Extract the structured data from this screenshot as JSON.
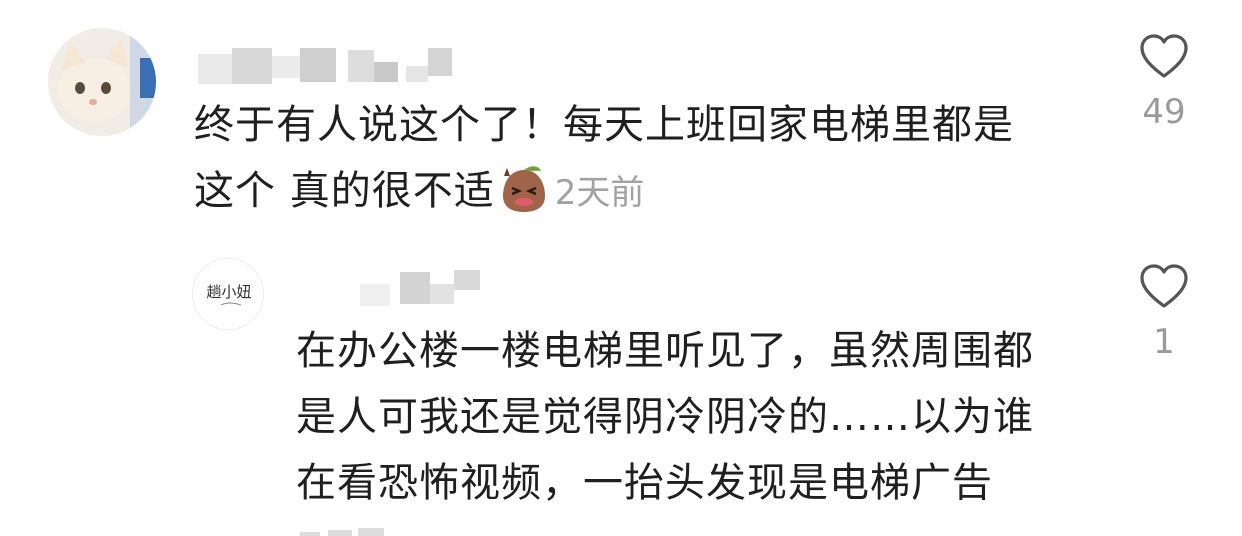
{
  "comments": [
    {
      "text_lines": [
        "终于有人说这个了！每天上班回家电梯里都是",
        "这个 真的很不适"
      ],
      "sticker_icon": "sweating-blob-icon",
      "time": "2天前",
      "likes": "49"
    },
    {
      "avatar_text": "趟小妞",
      "text_lines": [
        "在办公楼一楼电梯里听见了，虽然周围都",
        "是人可我还是觉得阴冷阴冷的……以为谁",
        "在看恐怖视频，一抬头发现是电梯广告"
      ],
      "likes": "1"
    }
  ],
  "colors": {
    "text": "#1f1f1f",
    "secondary": "#a2a2a2",
    "like_count": "#9a9a9a",
    "heart_outline": "#555555"
  }
}
